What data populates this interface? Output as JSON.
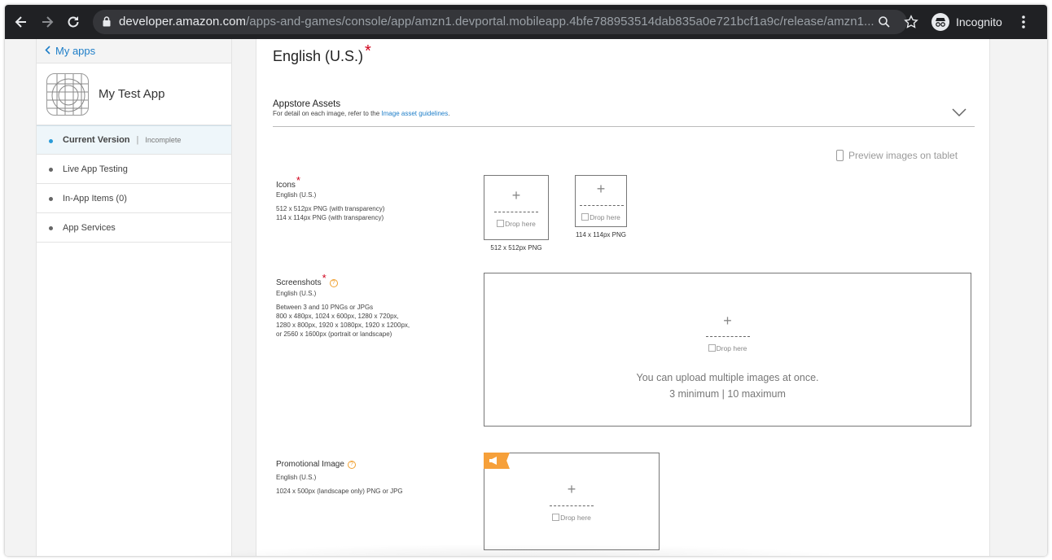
{
  "browser": {
    "url_host": "developer.amazon.com",
    "url_path": "/apps-and-games/console/app/amzn1.devportal.mobileapp.4bfe788953514dab835a0e721bcf1a9c/release/amzn1...",
    "profile_label": "Incognito"
  },
  "sidebar": {
    "back_label": "My apps",
    "app_name": "My Test App",
    "items": [
      {
        "label": "Current Version",
        "status": "Incomplete"
      },
      {
        "label": "Live App Testing"
      },
      {
        "label": "In-App Items (0)"
      },
      {
        "label": "App Services"
      }
    ]
  },
  "main": {
    "language_title": "English (U.S.)",
    "required_mark": "*",
    "assets": {
      "title": "Appstore Assets",
      "subtitle_prefix": "For detail on each image, refer to the ",
      "subtitle_link": "Image asset guidelines",
      "subtitle_suffix": "."
    },
    "preview_label": "Preview images on tablet",
    "drop_here": "Drop here",
    "help_glyph": "?",
    "icons": {
      "label": "Icons",
      "lang": "English (U.S.)",
      "desc1": "512 x 512px PNG (with transparency)",
      "desc2": "114 x 114px PNG (with transparency)",
      "cap_large": "512 x 512px PNG",
      "cap_small": "114 x 114px PNG"
    },
    "screenshots": {
      "label": "Screenshots",
      "lang": "English (U.S.)",
      "desc1": "Between 3 and 10 PNGs or JPGs",
      "desc2": "800 x 480px, 1024 x 600px, 1280 x 720px,",
      "desc3": "1280 x 800px, 1920 x 1080px, 1920 x 1200px,",
      "desc4": "or 2560 x 1600px (portrait or landscape)",
      "multi_line1": "You can upload multiple images at once.",
      "multi_line2": "3 minimum | 10 maximum"
    },
    "promo": {
      "label": "Promotional Image",
      "lang": "English (U.S.)",
      "desc1": "1024 x 500px (landscape only) PNG or JPG"
    }
  },
  "colors": {
    "accent": "#1e7ec8",
    "required": "#d0021b",
    "help": "#f0a030",
    "promo_tag": "#f6a03a",
    "toolbar": "#202124"
  }
}
